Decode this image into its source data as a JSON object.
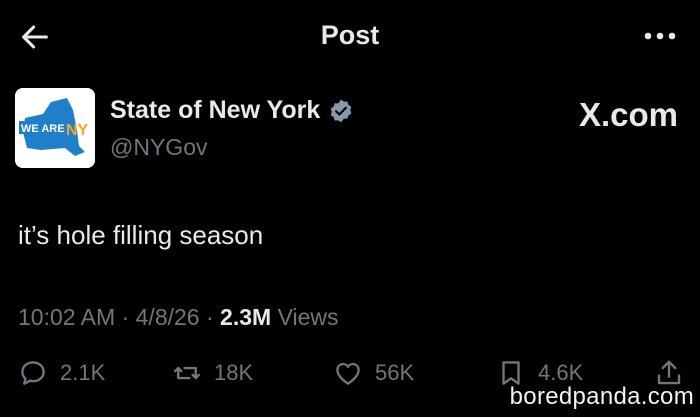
{
  "header": {
    "title": "Post",
    "back_icon": "arrow-left-icon",
    "more_icon": "more-horizontal-icon"
  },
  "author": {
    "name": "State of New York",
    "handle": "@NYGov",
    "avatar_text_1": "WE ARE",
    "avatar_text_2": "NY",
    "verified_color": "#829aab"
  },
  "brand": "X.com",
  "tweet": {
    "text": "it’s hole filling season"
  },
  "meta": {
    "time": "10:02 AM",
    "date": "4/8/26",
    "views_count": "2.3M",
    "views_label": "Views",
    "sep": "·"
  },
  "actions": {
    "replies": "2.1K",
    "reposts": "18K",
    "likes": "56K",
    "bookmarks": "4.6K"
  },
  "watermark": "boredpanda.com"
}
